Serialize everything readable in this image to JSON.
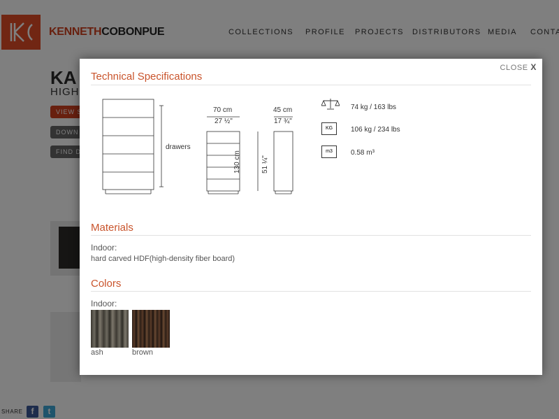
{
  "brand": {
    "part1": "KENNETH",
    "part2": "COBONPUE"
  },
  "nav": [
    "COLLECTIONS",
    "PROFILE",
    "PROJECTS",
    "DISTRIBUTORS",
    "MEDIA",
    "CONTA"
  ],
  "background": {
    "title": "KA",
    "subtitle": "HIGH",
    "buttons": [
      "VIEW S",
      "DOWN",
      "FIND D"
    ],
    "share_label": "SHARE"
  },
  "modal": {
    "close_label": "CLOSE",
    "close_x": "X",
    "tech_title": "Technical Specifications",
    "drawers_label": "drawers",
    "width_cm": "70 cm",
    "width_in": "27 ½\"",
    "depth_cm": "45 cm",
    "depth_in": "17 ¾\"",
    "height_cm": "130 cm",
    "height_in": "51 ¼\"",
    "specs": {
      "net_weight": "74 kg / 163 lbs",
      "gross_weight": "106 kg / 234 lbs",
      "volume": "0.58 m³",
      "kg_icon": "KG",
      "m3_icon": "m3"
    },
    "materials": {
      "title": "Materials",
      "label": "Indoor:",
      "value": "hard carved HDF(high-density fiber board)"
    },
    "colors": {
      "title": "Colors",
      "label": "Indoor:",
      "swatches": [
        {
          "name": "ash",
          "color": "#5a5750"
        },
        {
          "name": "brown",
          "color": "#3b2a20"
        }
      ]
    }
  }
}
